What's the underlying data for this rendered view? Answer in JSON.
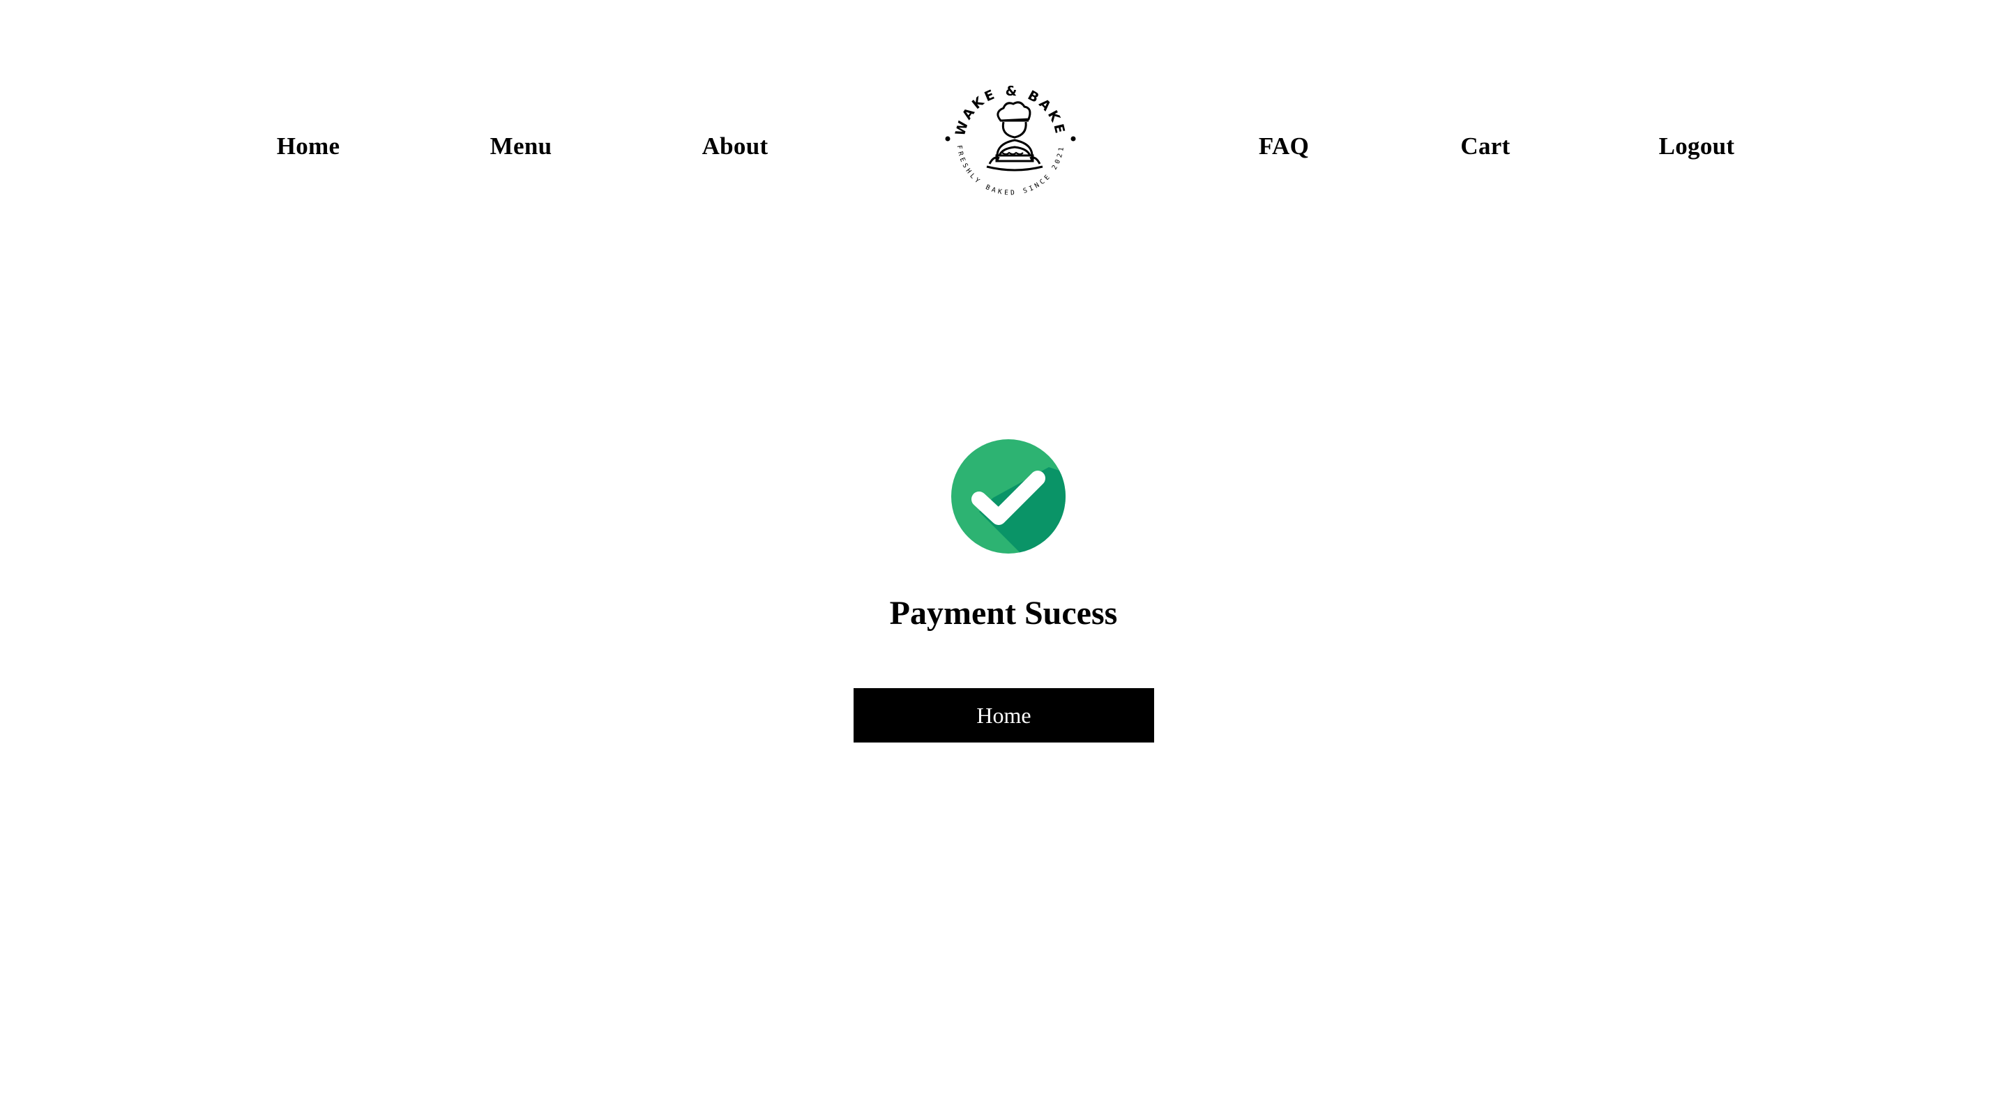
{
  "nav": {
    "left": [
      {
        "label": "Home"
      },
      {
        "label": "Menu"
      },
      {
        "label": "About"
      }
    ],
    "right": [
      {
        "label": "FAQ"
      },
      {
        "label": "Cart"
      },
      {
        "label": "Logout"
      }
    ]
  },
  "logo": {
    "top_text": "WAKE & BAKE",
    "bottom_text": "FRESHLY BAKED SINCE 2021",
    "icon": "baker-chef-icon"
  },
  "status": {
    "icon": "check-circle-icon",
    "icon_color": "#2db372",
    "icon_shadow_color": "#0a9467",
    "message": "Payment Sucess"
  },
  "actions": {
    "home_label": "Home",
    "button_color": "#000000"
  }
}
